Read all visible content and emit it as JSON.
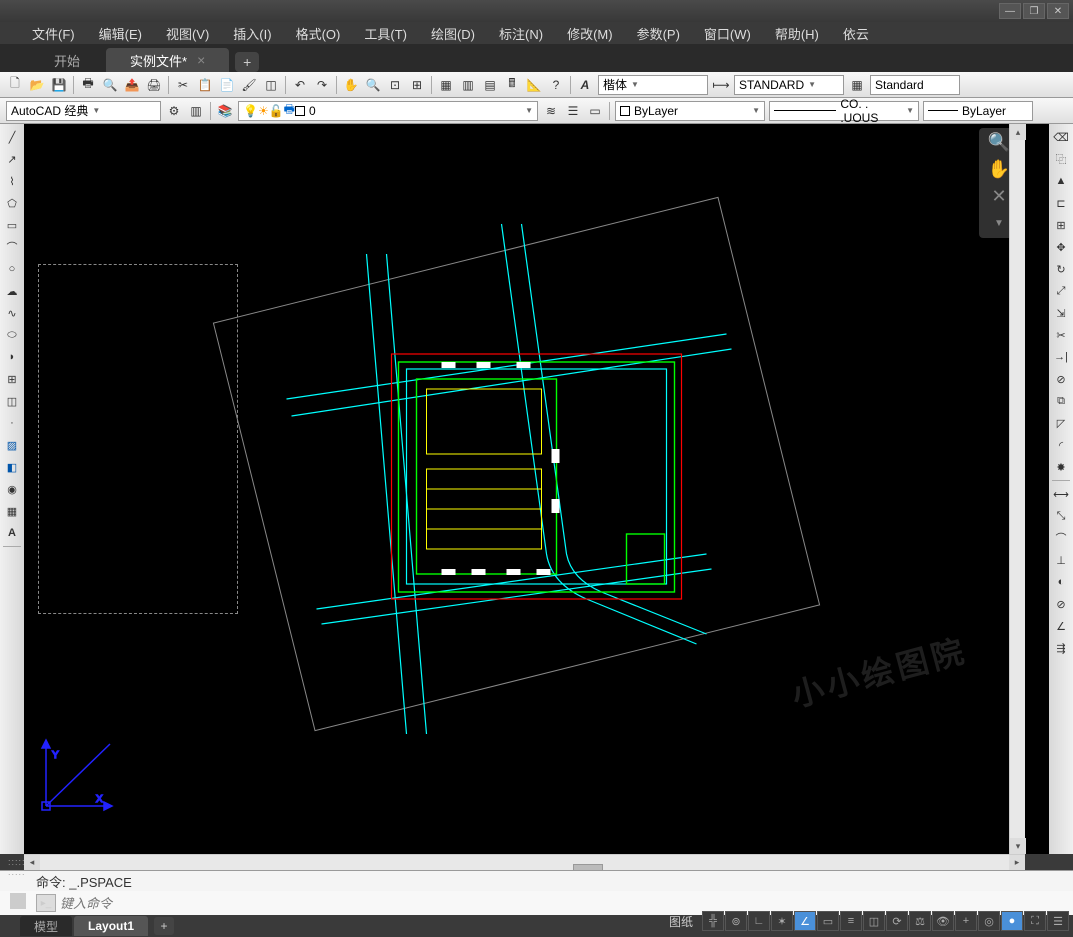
{
  "menubar": {
    "file": "文件(F)",
    "edit": "编辑(E)",
    "view": "视图(V)",
    "insert": "插入(I)",
    "format": "格式(O)",
    "tools": "工具(T)",
    "draw": "绘图(D)",
    "dimension": "标注(N)",
    "modify": "修改(M)",
    "parametric": "参数(P)",
    "window": "窗口(W)",
    "help": "帮助(H)",
    "yiyun": "依云"
  },
  "tabs": {
    "start": "开始",
    "active": "实例文件*"
  },
  "toolbar1": {
    "font": "楷体",
    "textstyle": "STANDARD",
    "dimstyle": "Standard"
  },
  "toolbar2": {
    "workspace": "AutoCAD 经典",
    "layer": "0",
    "color": "ByLayer",
    "linetype": "CO. . .UOUS",
    "lineweight": "ByLayer"
  },
  "command": {
    "history": "命令: _.PSPACE",
    "placeholder": "键入命令"
  },
  "bottomtabs": {
    "model": "模型",
    "layout1": "Layout1"
  },
  "statusbar": {
    "paper": "图纸"
  },
  "watermark": "小小绘图院"
}
